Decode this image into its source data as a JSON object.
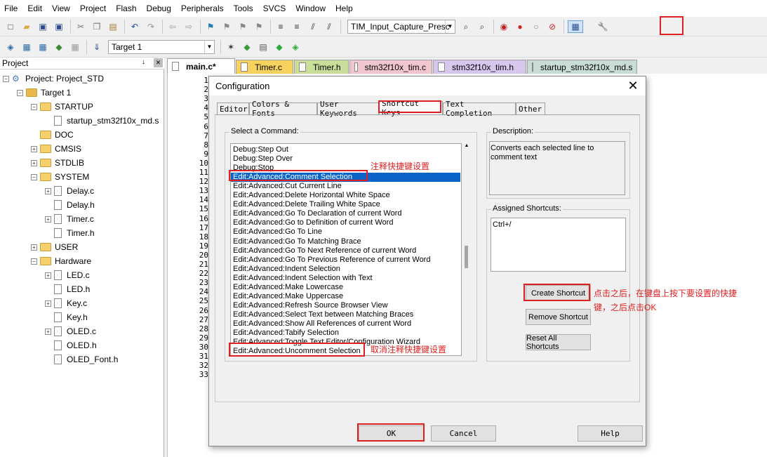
{
  "menu": [
    "File",
    "Edit",
    "View",
    "Project",
    "Flash",
    "Debug",
    "Peripherals",
    "Tools",
    "SVCS",
    "Window",
    "Help"
  ],
  "toolbar1": {
    "target_combo": "TIM_Input_Capture_Presc",
    "icons": [
      "new-file-icon",
      "open-folder-icon",
      "save-icon",
      "save-all-icon",
      "cut-icon",
      "copy-icon",
      "paste-icon",
      "undo-icon",
      "redo-icon",
      "navigate-back-icon",
      "navigate-forward-icon",
      "bookmark-icon",
      "prev-bookmark-icon",
      "next-bookmark-icon",
      "clear-bookmarks-icon",
      "indent-icon",
      "unindent-icon",
      "comment-icon",
      "uncomment-icon",
      "find-in-files-icon",
      "find-icon",
      "debug-session-icon",
      "breakpoint-icon",
      "breakpoint-disable-icon",
      "kill-breakpoints-icon",
      "window-layout-icon",
      "configuration-wrench-icon"
    ]
  },
  "toolbar2": {
    "target_select": "Target 1",
    "icons": [
      "translate-icon",
      "build-icon",
      "rebuild-icon",
      "batch-build-icon",
      "stop-build-icon",
      "download-icon",
      "options-wand-icon",
      "manage-components-icon",
      "select-packs-icon",
      "environment-icon",
      "pack-installer-icon"
    ]
  },
  "project_panel": {
    "title": "Project",
    "pin_glyph": "↓",
    "close_glyph": "✕",
    "tree": [
      {
        "label": "Project: Project_STD",
        "depth": 0,
        "kind": "project",
        "expander": "−"
      },
      {
        "label": "Target 1",
        "depth": 1,
        "kind": "target",
        "expander": "−"
      },
      {
        "label": "STARTUP",
        "depth": 2,
        "kind": "folder",
        "expander": "−"
      },
      {
        "label": "startup_stm32f10x_md.s",
        "depth": 3,
        "kind": "file",
        "expander": ""
      },
      {
        "label": "DOC",
        "depth": 2,
        "kind": "folder",
        "expander": ""
      },
      {
        "label": "CMSIS",
        "depth": 2,
        "kind": "folder",
        "expander": "+"
      },
      {
        "label": "STDLIB",
        "depth": 2,
        "kind": "folder",
        "expander": "+"
      },
      {
        "label": "SYSTEM",
        "depth": 2,
        "kind": "folder",
        "expander": "−"
      },
      {
        "label": "Delay.c",
        "depth": 3,
        "kind": "file",
        "expander": "+"
      },
      {
        "label": "Delay.h",
        "depth": 3,
        "kind": "file",
        "expander": ""
      },
      {
        "label": "Timer.c",
        "depth": 3,
        "kind": "file",
        "expander": "+"
      },
      {
        "label": "Timer.h",
        "depth": 3,
        "kind": "file",
        "expander": ""
      },
      {
        "label": "USER",
        "depth": 2,
        "kind": "folder",
        "expander": "+"
      },
      {
        "label": "Hardware",
        "depth": 2,
        "kind": "folder",
        "expander": "−"
      },
      {
        "label": "LED.c",
        "depth": 3,
        "kind": "file",
        "expander": "+"
      },
      {
        "label": "LED.h",
        "depth": 3,
        "kind": "file",
        "expander": ""
      },
      {
        "label": "Key.c",
        "depth": 3,
        "kind": "file",
        "expander": "+"
      },
      {
        "label": "Key.h",
        "depth": 3,
        "kind": "file",
        "expander": ""
      },
      {
        "label": "OLED.c",
        "depth": 3,
        "kind": "file",
        "expander": "+"
      },
      {
        "label": "OLED.h",
        "depth": 3,
        "kind": "file",
        "expander": ""
      },
      {
        "label": "OLED_Font.h",
        "depth": 3,
        "kind": "file",
        "expander": ""
      }
    ]
  },
  "editor_tabs": [
    {
      "label": "main.c*",
      "color": "#f0f0f0",
      "active": true
    },
    {
      "label": "Timer.c",
      "color": "#f7d25e",
      "active": false
    },
    {
      "label": "Timer.h",
      "color": "#c9de9a",
      "active": false
    },
    {
      "label": "stm32f10x_tim.c",
      "color": "#f2c6cf",
      "active": false
    },
    {
      "label": "stm32f10x_tim.h",
      "color": "#d7c6ee",
      "active": false
    },
    {
      "label": "startup_stm32f10x_md.s",
      "color": "#c8ddd8",
      "active": false
    }
  ],
  "line_numbers": [
    "1",
    "2",
    "3",
    "4",
    "5",
    "6",
    "7",
    "8",
    "9",
    "10",
    "11",
    "12",
    "13",
    "14",
    "15",
    "16",
    "17",
    "18",
    "19",
    "20",
    "21",
    "22",
    "23",
    "24",
    "25",
    "26",
    "27",
    "28",
    "29",
    "30",
    "31",
    "32",
    "33"
  ],
  "dialog": {
    "title": "Configuration",
    "close_glyph": "✕",
    "tabs": [
      "Editor",
      "Colors & Fonts",
      "User Keywords",
      "Shortcut Keys",
      "Text Completion",
      "Other"
    ],
    "active_tab": "Shortcut Keys",
    "select_command_label": "Select a Command:",
    "commands": [
      "Debug:Step Out",
      "Debug:Step Over",
      "Debug:Stop",
      "Edit:Advanced:Comment Selection",
      "Edit:Advanced:Cut Current Line",
      "Edit:Advanced:Delete Horizontal White Space",
      "Edit:Advanced:Delete Trailing White Space",
      "Edit:Advanced:Go To Declaration of current Word",
      "Edit:Advanced:Go to Definition of current Word",
      "Edit:Advanced:Go To Line",
      "Edit:Advanced:Go To Matching Brace",
      "Edit:Advanced:Go To Next Reference of current Word",
      "Edit:Advanced:Go To Previous Reference of current Word",
      "Edit:Advanced:Indent Selection",
      "Edit:Advanced:Indent Selection with Text",
      "Edit:Advanced:Make Lowercase",
      "Edit:Advanced:Make Uppercase",
      "Edit:Advanced:Refresh Source Browser View",
      "Edit:Advanced:Select Text between Matching Braces",
      "Edit:Advanced:Show All References of current Word",
      "Edit:Advanced:Tabify Selection",
      "Edit:Advanced:Toggle Text Editor/Configuration Wizard",
      "Edit:Advanced:Uncomment Selection"
    ],
    "selected_command": "Edit:Advanced:Comment Selection",
    "description_label": "Description:",
    "description_text": "Converts each selected line to comment text",
    "assigned_label": "Assigned Shortcuts:",
    "assigned_shortcut": "Ctrl+/",
    "create_shortcut": "Create Shortcut",
    "remove_shortcut": "Remove Shortcut",
    "reset_shortcuts": "Reset All Shortcuts",
    "ok": "OK",
    "cancel": "Cancel",
    "help": "Help"
  },
  "annotations": {
    "comment_note": "注释快捷键设置",
    "uncomment_note": "取消注释快捷键设置",
    "create_note_line1": "点击之后，在键盘上按下要设置的快捷",
    "create_note_line2": "键，之后点击OK",
    "highlight_color": "#e02020"
  }
}
